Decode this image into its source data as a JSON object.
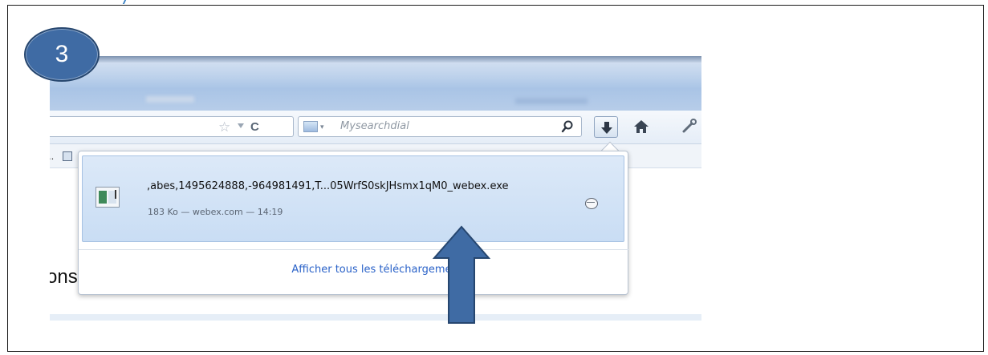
{
  "step": {
    "number": "3"
  },
  "browser": {
    "search": {
      "placeholder": "Mysearchdial"
    },
    "bookmarks_overflow": "..",
    "page_partial_text": "ons"
  },
  "downloads_panel": {
    "item": {
      "filename": ",abes,1495624888,-964981491,T...05WrfS0skJHsmx1qM0_webex.exe",
      "meta": "183 Ko — webex.com — 14:19"
    },
    "show_all_label": "Afficher tous les téléchargements"
  },
  "colors": {
    "step_circle": "#3f6ba4",
    "arrow_fill": "#3f6ba4",
    "link": "#2a62c8"
  },
  "icons": [
    "star-icon",
    "reload-icon",
    "search-engine-icon",
    "magnifier-icon",
    "download-arrow-icon",
    "home-icon",
    "tools-icon",
    "file-exe-icon",
    "open-folder-icon",
    "pointer-arrow-icon"
  ]
}
